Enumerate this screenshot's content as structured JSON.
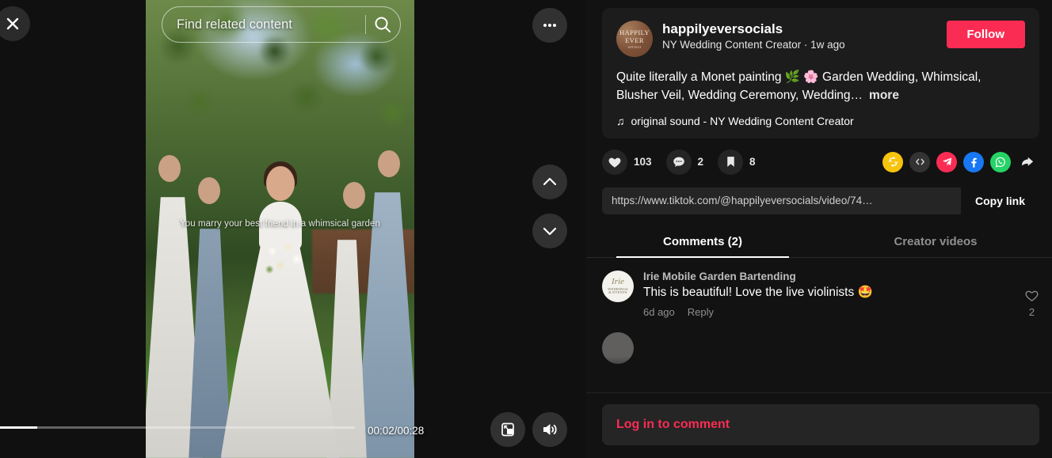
{
  "video": {
    "search_placeholder": "Find related content",
    "search_value": "",
    "subtitle": "You marry your best friend in a whimsical garden",
    "current_time": "00:02",
    "duration": "00:28",
    "time_label": "00:02/00:28",
    "progress_percent": 10.5,
    "close_label": "Close",
    "more_label": "More",
    "prev_label": "Previous video",
    "next_label": "Next video",
    "pip_label": "Picture in picture",
    "volume_label": "Volume"
  },
  "author": {
    "username": "happilyeversocials",
    "subtitle": "NY Wedding Content Creator · 1w ago",
    "display_name": "NY Wedding Content Creator",
    "posted_ago": "1w ago",
    "follow_label": "Follow",
    "avatar_line1": "HAPPILY",
    "avatar_line2": "EVER",
    "avatar_line3": "SOCIALS"
  },
  "post": {
    "description": "Quite literally a Monet painting 🌿 🌸 Garden Wedding, Whimsical, Blusher Veil, Wedding Ceremony, Wedding…",
    "more_label": "more",
    "sound_icon": "♫",
    "sound_text": "original sound - NY Wedding Content Creator"
  },
  "engagement": {
    "like_count": "103",
    "comment_count": "2",
    "save_count": "8",
    "like_icon": "heart-filled-icon",
    "comment_icon": "comment-bubble-icon",
    "save_icon": "bookmark-icon",
    "share_targets": [
      {
        "name": "repost",
        "color": "#f6c30d"
      },
      {
        "name": "embed",
        "color": "#333333"
      },
      {
        "name": "telegram",
        "color": "#fb2c53"
      },
      {
        "name": "facebook",
        "color": "#1877f2"
      },
      {
        "name": "whatsapp",
        "color": "#25d366"
      },
      {
        "name": "share-more",
        "color": "#ffffff"
      }
    ]
  },
  "link": {
    "url": "https://www.tiktok.com/@happilyeversocials/video/74…",
    "copy_label": "Copy link"
  },
  "tabs": [
    {
      "label": "Comments (2)",
      "active": true
    },
    {
      "label": "Creator videos",
      "active": false
    }
  ],
  "comments": [
    {
      "author": "Irie Mobile Garden Bartending",
      "text": "This is beautiful! Love the live violinists 🤩",
      "time": "6d ago",
      "reply_label": "Reply",
      "likes": "2",
      "avatar_line1": "Irie",
      "avatar_line2": "WEDDINGS",
      "avatar_line3": "& EVENTS"
    }
  ],
  "login": {
    "text": "Log in to comment"
  },
  "colors": {
    "brand_red": "#fb2c53",
    "background": "#121212",
    "card": "#1c1c1c"
  }
}
